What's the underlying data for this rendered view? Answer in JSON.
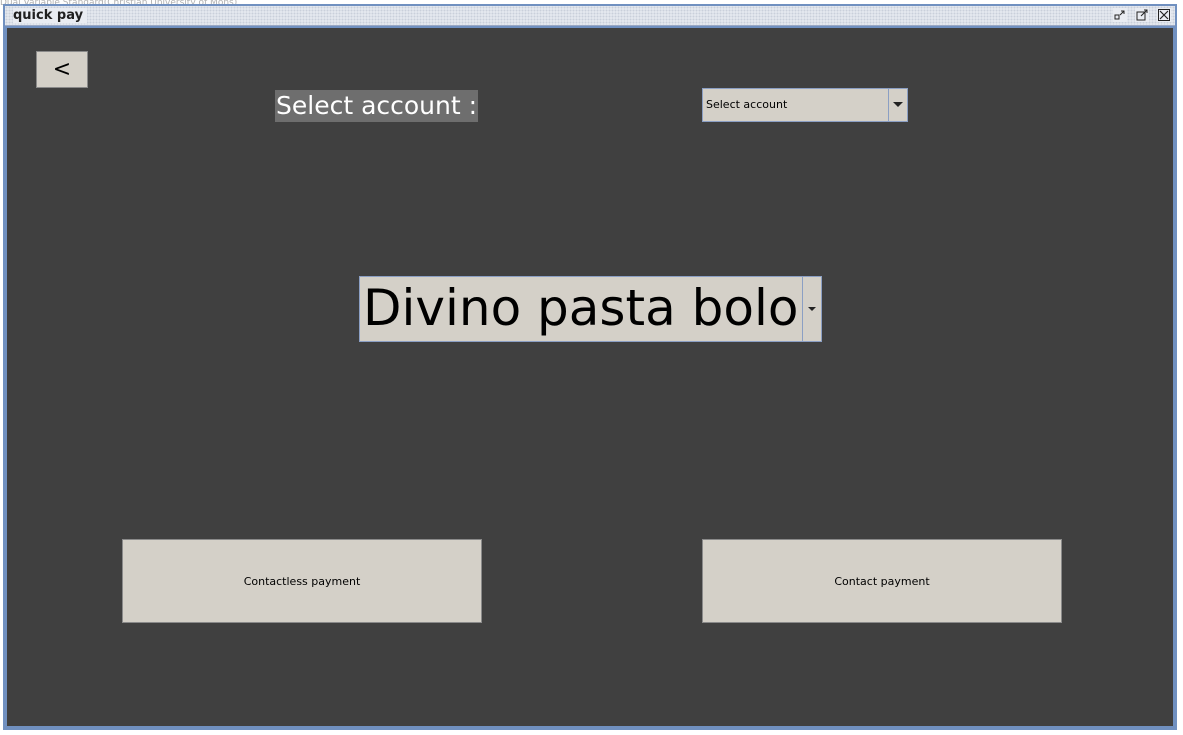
{
  "desktop": {
    "background_text": "Dual Variable Standard(Christian University of Mons)"
  },
  "window": {
    "title": "quick pay",
    "controls": [
      "minimize-icon",
      "maximize-icon",
      "close-icon"
    ]
  },
  "main": {
    "back_label": "<",
    "account_label": "Select account :",
    "account_select": {
      "selected": "Select account"
    },
    "item_select": {
      "selected": "Divino pasta bolo"
    },
    "contactless_label": "Contactless payment",
    "contact_label": "Contact payment"
  },
  "colors": {
    "panel_bg": "#404040",
    "control_bg": "#d4d0c8",
    "label_bg": "#6e6e6e",
    "window_border": "#7090c0"
  }
}
